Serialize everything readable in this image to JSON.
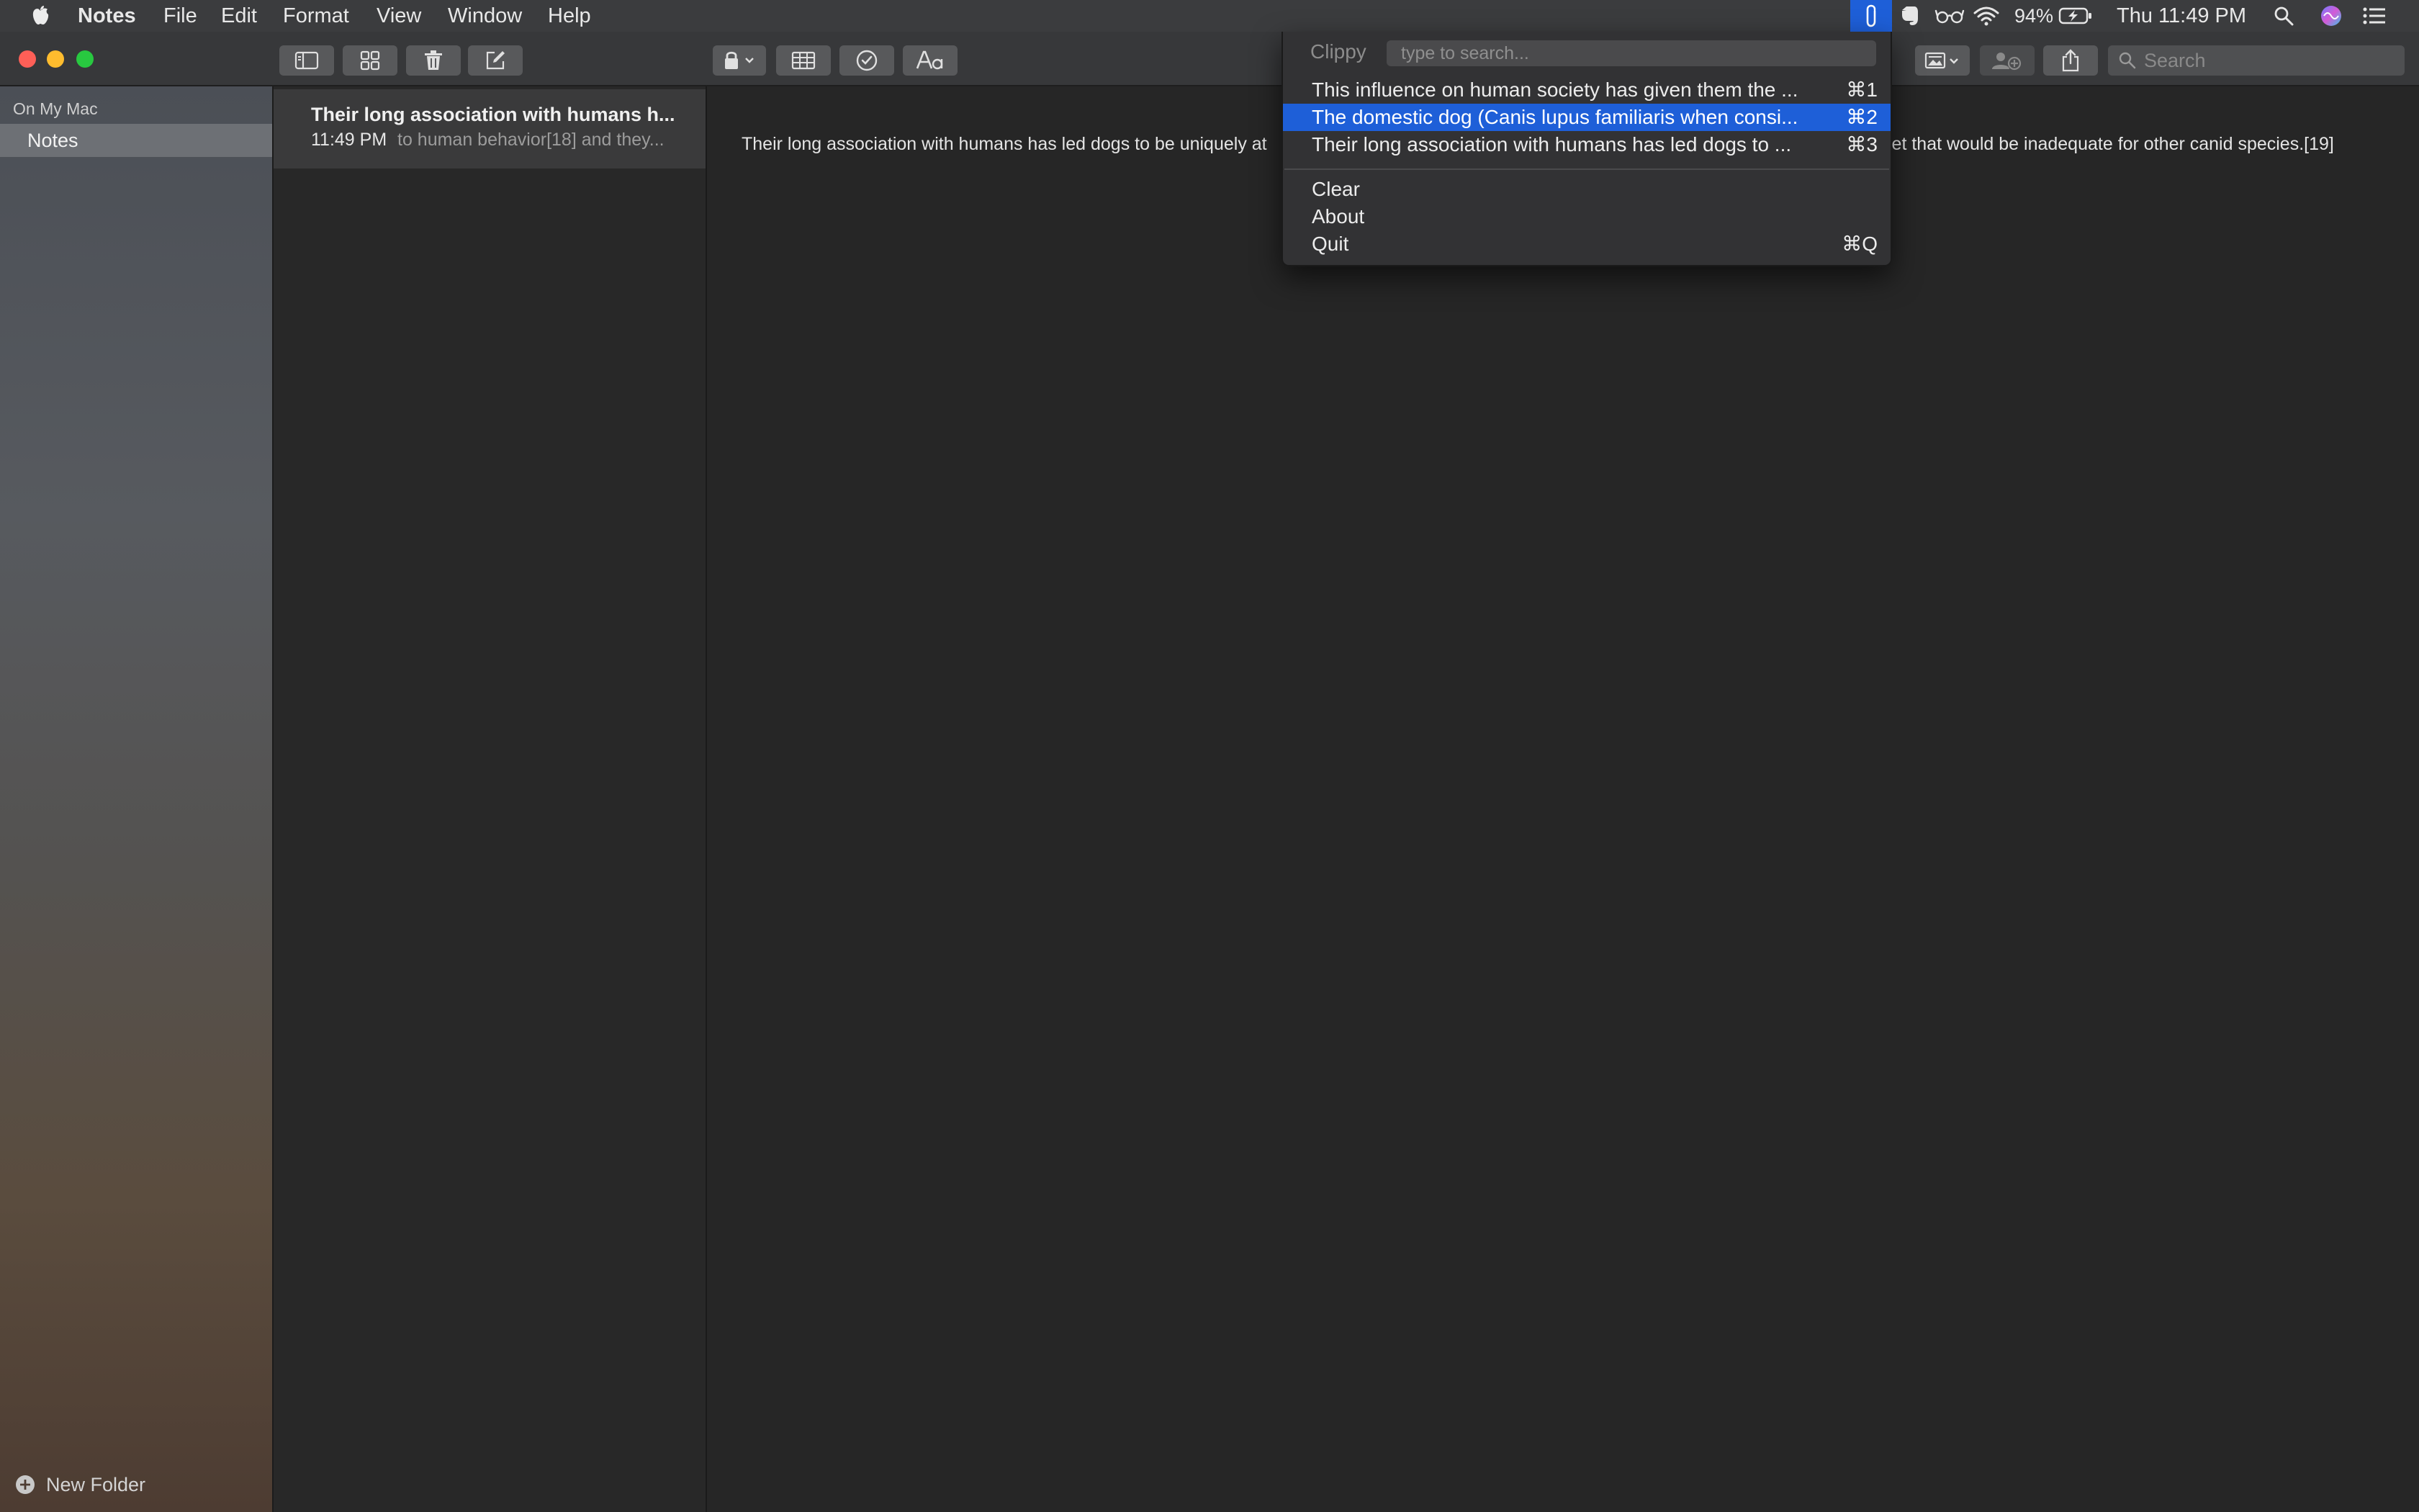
{
  "menubar": {
    "app_name": "Notes",
    "menus": [
      "File",
      "Edit",
      "Format",
      "View",
      "Window",
      "Help"
    ],
    "battery": "94%",
    "clock": "Thu 11:49 PM"
  },
  "sidebar": {
    "section_label": "On My Mac",
    "folders": [
      {
        "label": "Notes",
        "selected": true
      }
    ],
    "new_folder_label": "New Folder"
  },
  "note_list": {
    "notes": [
      {
        "title": "Their long association with humans h...",
        "time": "11:49 PM",
        "preview": "to human behavior[18] and they..."
      }
    ]
  },
  "toolbar": {
    "search_placeholder": "Search"
  },
  "editor": {
    "body_left": "Their long association with humans has led dogs to be uniquely at",
    "body_right": "iet that would be inadequate for other canid species.[19]"
  },
  "clippy": {
    "title": "Clippy",
    "search_placeholder": "type to search...",
    "history": [
      {
        "label": "This influence on human society has given them the ...",
        "shortcut": "⌘1",
        "highlighted": false
      },
      {
        "label": "The domestic dog (Canis lupus familiaris when consi...",
        "shortcut": "⌘2",
        "highlighted": true
      },
      {
        "label": "Their long association with humans has led dogs to ...",
        "shortcut": "⌘3",
        "highlighted": false
      }
    ],
    "actions": [
      {
        "label": "Clear",
        "shortcut": ""
      },
      {
        "label": "About",
        "shortcut": ""
      },
      {
        "label": "Quit",
        "shortcut": "⌘Q"
      }
    ]
  },
  "colors": {
    "menu_highlight": "#1e5fd8",
    "close": "#fe5f57",
    "minimize": "#febc2e",
    "zoom": "#28c840"
  },
  "icons": {
    "menubar": [
      "apple-icon",
      "clippy-paperclip-icon",
      "evernote-icon",
      "reading-glasses-icon",
      "wifi-icon",
      "battery-charging-icon",
      "spotlight-search-icon",
      "siri-icon",
      "notification-center-icon"
    ],
    "toolbar": [
      "sidebar-toggle-icon",
      "gallery-view-icon",
      "trash-icon",
      "compose-icon",
      "lock-icon",
      "table-icon",
      "checklist-icon",
      "format-text-icon",
      "insert-media-icon",
      "add-people-icon",
      "share-icon",
      "search-icon"
    ]
  }
}
